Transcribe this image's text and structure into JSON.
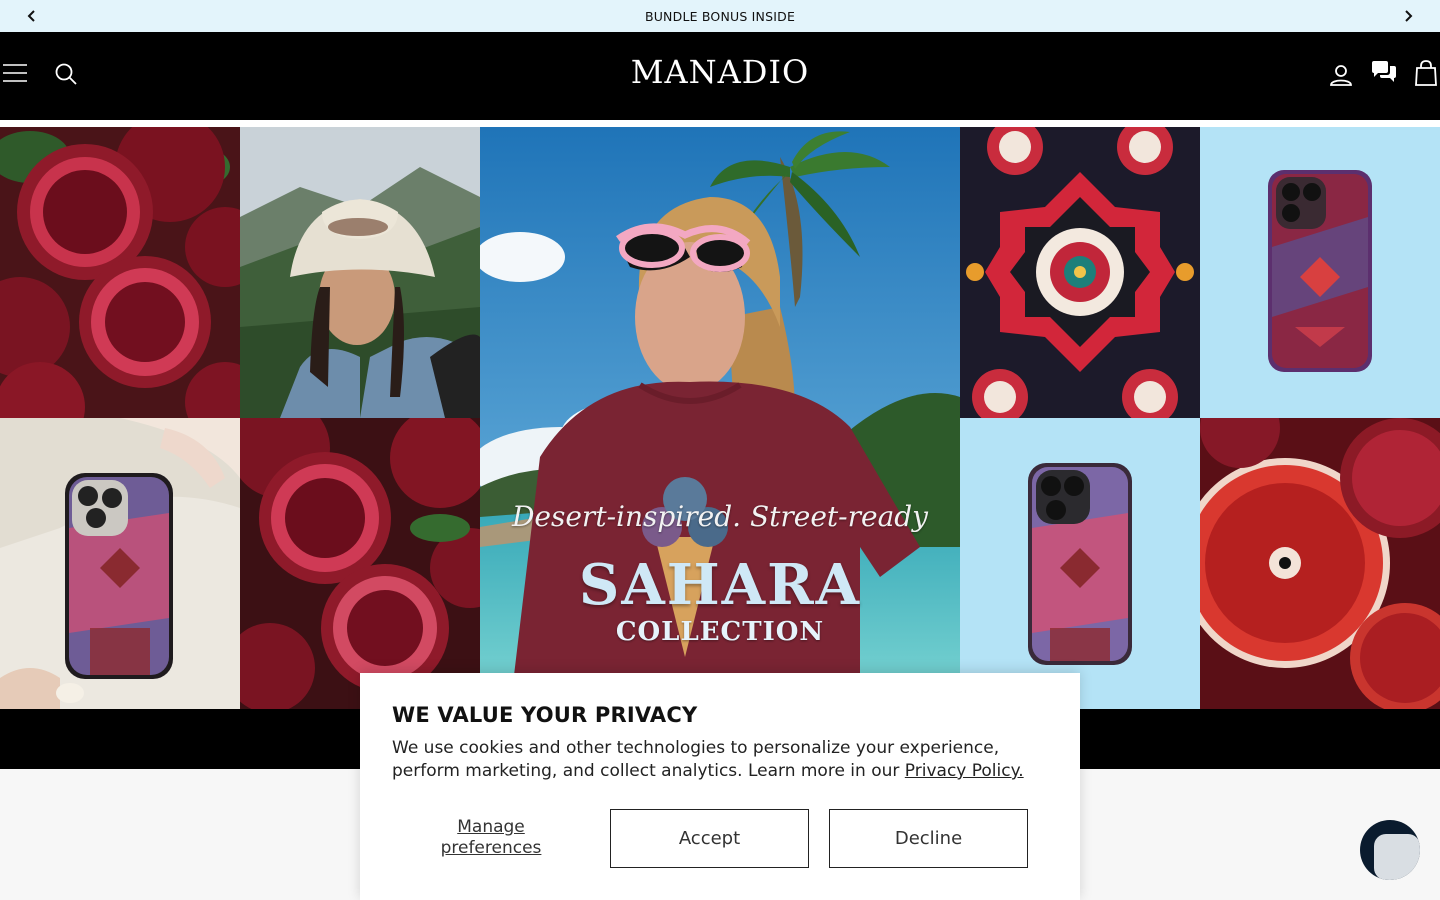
{
  "announcement": {
    "text": "BUNDLE BONUS INSIDE",
    "prev_icon": "chevron-left-icon",
    "next_icon": "chevron-right-icon"
  },
  "header": {
    "logo": "MANADIO",
    "icons": [
      "menu-icon",
      "search-icon",
      "account-icon",
      "chat-icon",
      "cart-icon"
    ],
    "background": "#000000"
  },
  "hero": {
    "tagline": "Desert-inspired. Street-ready",
    "title": "SAHARA",
    "subtitle": "COLLECTION",
    "tiles": [
      "pomegranates",
      "woman in bucket hat",
      "woman in sunglasses on beach",
      "red persian rug pattern",
      "phone case on light blue",
      "phone case in hand",
      "pomegranates",
      "phone case on light blue",
      "blood orange and pomegranate"
    ]
  },
  "cookie": {
    "title": "WE VALUE YOUR PRIVACY",
    "body": "We use cookies and other technologies to personalize your experience, perform marketing, and collect analytics. Learn more in our",
    "link": "Privacy Policy.",
    "manage": "Manage preferences",
    "accept": "Accept",
    "decline": "Decline"
  },
  "colors": {
    "announce_bg": "#e3f4fb",
    "header_bg": "#000000",
    "pomegranate": "#8f1a2a",
    "sky": "#3aa3d9",
    "light_blue": "#b4e3f6"
  }
}
